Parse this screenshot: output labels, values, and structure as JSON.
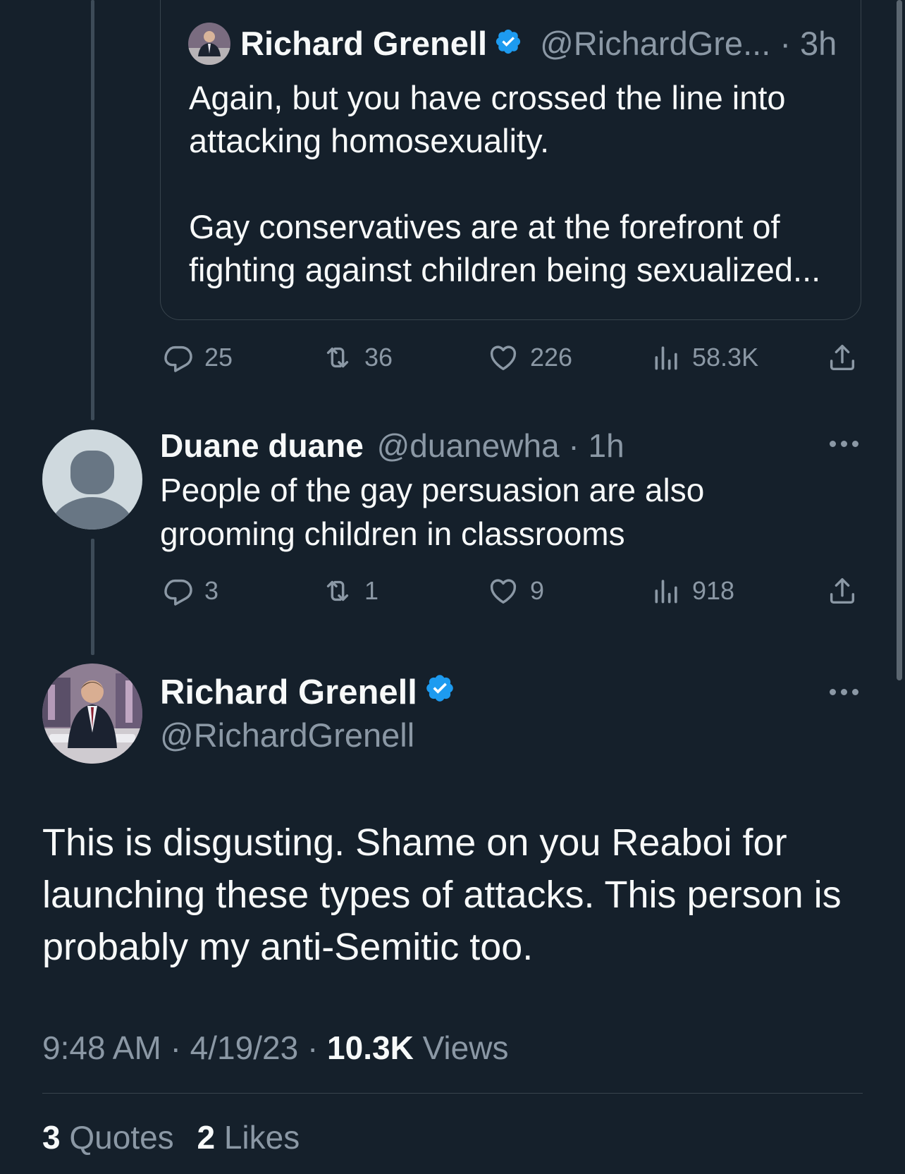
{
  "quoted_tweet": {
    "author_name": "Richard Grenell",
    "handle": "@RichardGre...",
    "time": "· 3h",
    "text": "Again, but you have crossed the line into attacking homosexuality.\n\nGay conservatives are at the forefront of fighting against children being sexualized..."
  },
  "quoted_actions": {
    "replies": "25",
    "retweets": "36",
    "likes": "226",
    "views": "58.3K"
  },
  "reply_tweet": {
    "author_name": "Duane duane",
    "handle": "@duanewha",
    "time": "· 1h",
    "text": "People of the gay persuasion are also grooming children in classrooms"
  },
  "reply_actions": {
    "replies": "3",
    "retweets": "1",
    "likes": "9",
    "views": "918"
  },
  "main_tweet": {
    "author_name": "Richard Grenell",
    "handle": "@RichardGrenell",
    "text": "This is disgusting. Shame on you Reaboi for launching these types of attacks. This person is probably my anti-Semitic too.",
    "time": "9:48 AM",
    "date": "4/19/23",
    "views_count": "10.3K",
    "views_label": "Views",
    "sep": "·"
  },
  "engagement": {
    "quotes_count": "3",
    "quotes_label": "Quotes",
    "likes_count": "2",
    "likes_label": "Likes"
  },
  "colors": {
    "background": "#15202b",
    "text": "#f7f9f9",
    "muted": "#8b98a5",
    "verified": "#1d9bf0",
    "border": "#38444d"
  }
}
